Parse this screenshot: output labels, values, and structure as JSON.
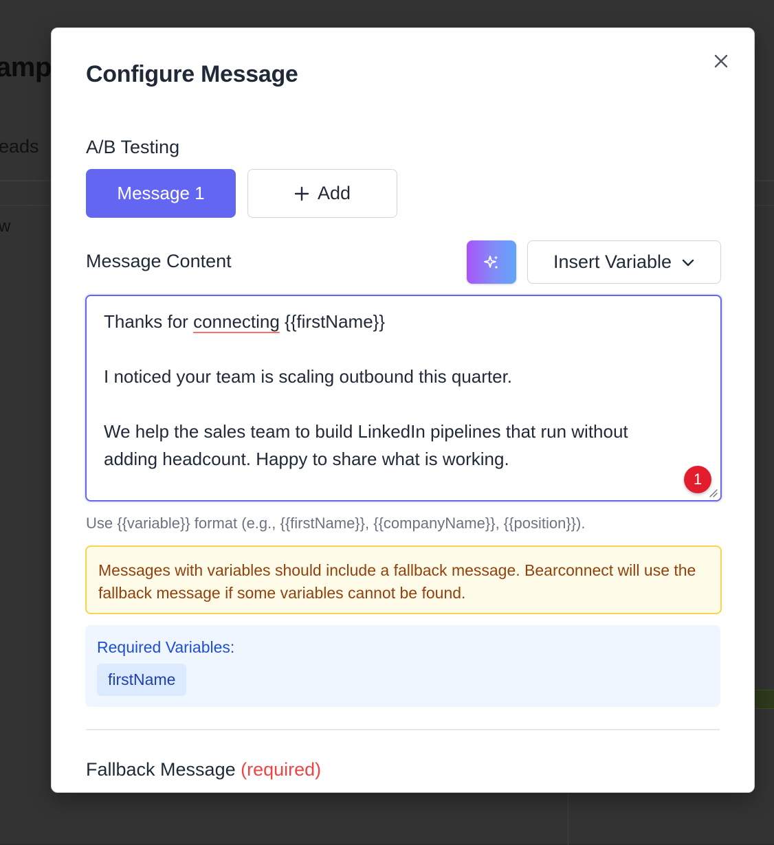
{
  "background": {
    "title_fragment": "amp",
    "tab_fragment": "eads",
    "row_fragment": "w"
  },
  "modal": {
    "title": "Configure Message",
    "ab_testing": {
      "label": "A/B Testing",
      "tabs": [
        {
          "label": "Message 1",
          "active": true
        }
      ],
      "add_label": "Add"
    },
    "content": {
      "label": "Message Content",
      "ai_icon": "sparkles-icon",
      "insert_variable_label": "Insert Variable",
      "lines": [
        {
          "before": "Thanks for ",
          "underlined": "connecting",
          "after": " {{firstName}}"
        },
        {
          "text": "I noticed your team is scaling outbound this quarter."
        },
        {
          "text": "We help the sales team to build LinkedIn pipelines that run without"
        },
        {
          "text": "adding headcount. Happy to share what is working."
        }
      ],
      "badge_count": "1"
    },
    "help_text": "Use {{variable}} format (e.g., {{firstName}}, {{companyName}}, {{position}}).",
    "warning": "Messages with variables should include a fallback message. Bearconnect will use the fallback message if some variables cannot be found.",
    "required_variables": {
      "title": "Required Variables:",
      "items": [
        "firstName"
      ]
    },
    "fallback": {
      "label": "Fallback Message",
      "required_label": "(required)"
    }
  },
  "colors": {
    "primary": "#6366f1",
    "warning_bg": "#fefce8",
    "warning_border": "#fcd34d",
    "warning_text": "#92400e",
    "info_bg": "#eff6ff",
    "info_text": "#1d4ed8",
    "required": "#ef4444",
    "badge": "#e11d2e"
  }
}
